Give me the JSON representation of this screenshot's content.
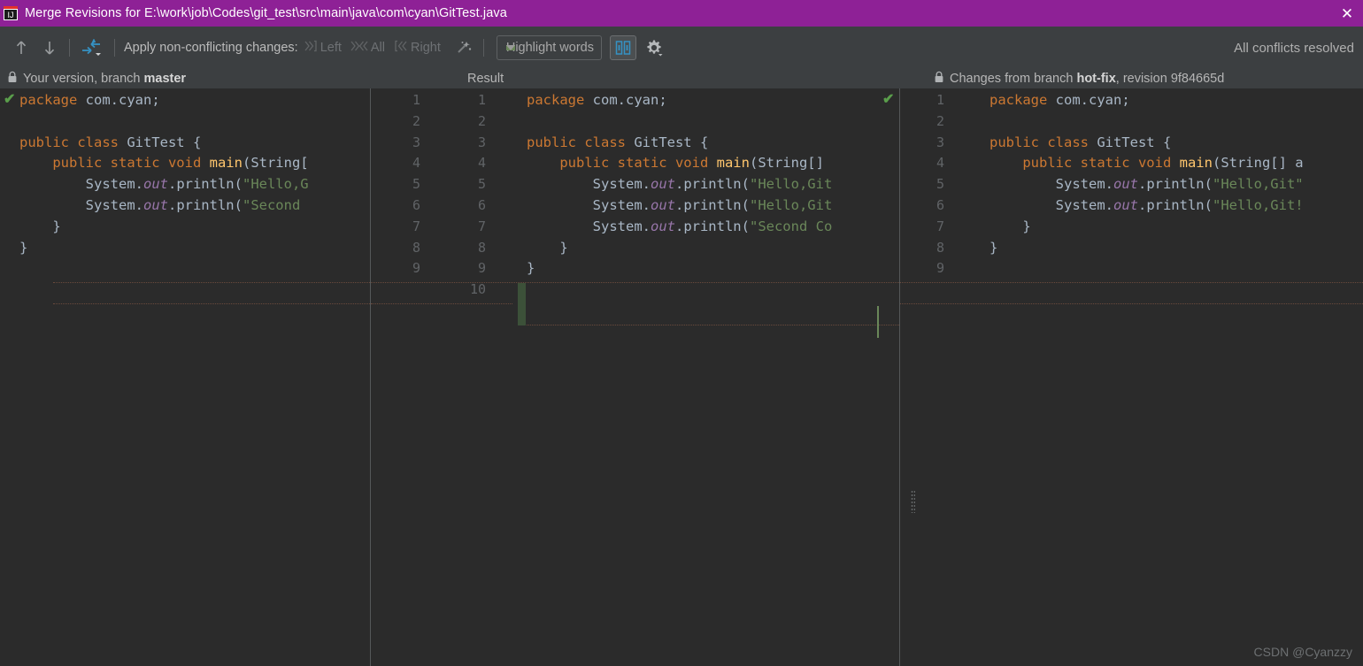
{
  "window": {
    "title": "Merge Revisions for E:\\work\\job\\Codes\\git_test\\src\\main\\java\\com\\cyan\\GitTest.java",
    "icon": "intellij-idea-icon",
    "close_label": "✕",
    "titlebar_color": "#8e2196"
  },
  "toolbar": {
    "prev_difference_icon": "arrow-up-icon",
    "next_difference_icon": "arrow-down-icon",
    "apply_changes_icon": "apply-changes-icon",
    "apply_label": "Apply non-conflicting changes:",
    "actions": [
      {
        "label": "Left",
        "icon": "chevron-right-bracket-icon",
        "enabled": false
      },
      {
        "label": "All",
        "icon": "chevrons-both-icon",
        "enabled": false
      },
      {
        "label": "Right",
        "icon": "bracket-chevron-left-icon",
        "enabled": false
      }
    ],
    "magic_resolve_icon": "magic-wand-icon",
    "highlight_mode": "Highlight words",
    "highlight_caret_icon": "chevron-down-icon",
    "collapse_panes_icon": "two-pane-toggle-icon",
    "collapse_panes_active": true,
    "settings_icon": "gear-icon",
    "conflicts_status": "All conflicts resolved"
  },
  "panes": {
    "left": {
      "lock_icon": "lock-icon",
      "header_prefix": "Your version, branch ",
      "header_branch": "master",
      "accept_icon": "green-check-icon",
      "lines": [
        [
          {
            "t": "kw",
            "v": "package"
          },
          {
            "t": "id",
            "v": " com.cyan;"
          }
        ],
        [],
        [
          {
            "t": "kw",
            "v": "public class"
          },
          {
            "t": "id",
            "v": " GitTest {"
          }
        ],
        [
          {
            "t": "id",
            "v": "    "
          },
          {
            "t": "kw",
            "v": "public static void"
          },
          {
            "t": "fn",
            "v": " main"
          },
          {
            "t": "pun",
            "v": "(String["
          }
        ],
        [
          {
            "t": "id",
            "v": "        System."
          },
          {
            "t": "fld",
            "v": "out"
          },
          {
            "t": "id",
            "v": ".println("
          },
          {
            "t": "str",
            "v": "\"Hello,G"
          }
        ],
        [
          {
            "t": "id",
            "v": "        System."
          },
          {
            "t": "fld",
            "v": "out"
          },
          {
            "t": "id",
            "v": ".println("
          },
          {
            "t": "str",
            "v": "\"Second "
          }
        ],
        [
          {
            "t": "id",
            "v": "    }"
          }
        ],
        [
          {
            "t": "id",
            "v": "}"
          }
        ]
      ]
    },
    "result": {
      "header": "Result",
      "accept_icon": "green-check-icon",
      "gutter_left": [
        "1",
        "2",
        "3",
        "4",
        "5",
        "6",
        "7",
        "8",
        "9"
      ],
      "gutter_right": [
        "1",
        "2",
        "3",
        "4",
        "5",
        "6",
        "7",
        "8",
        "9",
        "10"
      ],
      "lines": [
        [
          {
            "t": "kw",
            "v": "package"
          },
          {
            "t": "id",
            "v": " com.cyan;"
          }
        ],
        [],
        [
          {
            "t": "kw",
            "v": "public class"
          },
          {
            "t": "id",
            "v": " GitTest {"
          }
        ],
        [
          {
            "t": "id",
            "v": "    "
          },
          {
            "t": "kw",
            "v": "public static void"
          },
          {
            "t": "fn",
            "v": " main"
          },
          {
            "t": "pun",
            "v": "(String[]"
          }
        ],
        [
          {
            "t": "id",
            "v": "        System."
          },
          {
            "t": "fld",
            "v": "out"
          },
          {
            "t": "id",
            "v": ".println("
          },
          {
            "t": "str",
            "v": "\"Hello,Git"
          }
        ],
        [
          {
            "t": "id",
            "v": "        System."
          },
          {
            "t": "fld",
            "v": "out"
          },
          {
            "t": "id",
            "v": ".println("
          },
          {
            "t": "str",
            "v": "\"Hello,Git"
          }
        ],
        [
          {
            "t": "id",
            "v": "        System."
          },
          {
            "t": "fld",
            "v": "out"
          },
          {
            "t": "id",
            "v": ".println("
          },
          {
            "t": "str",
            "v": "\"Second Co"
          }
        ],
        [
          {
            "t": "id",
            "v": "    }"
          }
        ],
        [
          {
            "t": "id",
            "v": "}"
          }
        ]
      ]
    },
    "right": {
      "lock_icon": "lock-icon",
      "header_prefix": "Changes from branch ",
      "header_branch": "hot-fix",
      "header_suffix": ", revision 9f84665d",
      "accept_icon": "green-check-icon",
      "gutter": [
        "1",
        "2",
        "3",
        "4",
        "5",
        "6",
        "7",
        "8",
        "9"
      ],
      "lines": [
        [
          {
            "t": "kw",
            "v": "package"
          },
          {
            "t": "id",
            "v": " com.cyan;"
          }
        ],
        [],
        [
          {
            "t": "kw",
            "v": "public class"
          },
          {
            "t": "id",
            "v": " GitTest {"
          }
        ],
        [
          {
            "t": "id",
            "v": "    "
          },
          {
            "t": "kw",
            "v": "public static void"
          },
          {
            "t": "fn",
            "v": " main"
          },
          {
            "t": "pun",
            "v": "(String[] a"
          }
        ],
        [
          {
            "t": "id",
            "v": "        System."
          },
          {
            "t": "fld",
            "v": "out"
          },
          {
            "t": "id",
            "v": ".println("
          },
          {
            "t": "str",
            "v": "\"Hello,Git\""
          }
        ],
        [
          {
            "t": "id",
            "v": "        System."
          },
          {
            "t": "fld",
            "v": "out"
          },
          {
            "t": "id",
            "v": ".println("
          },
          {
            "t": "str",
            "v": "\"Hello,Git!"
          }
        ],
        [
          {
            "t": "id",
            "v": "    }"
          }
        ],
        [
          {
            "t": "id",
            "v": "}"
          }
        ]
      ]
    }
  },
  "watermark": "CSDN @Cyanzzy",
  "colors": {
    "title_bg": "#8e2196",
    "toolbar_bg": "#3c3f41",
    "editor_bg": "#2b2b2b",
    "keyword": "#cc7832",
    "string": "#6a8759",
    "field": "#9876aa",
    "method": "#ffc66d",
    "identifier": "#a9b7c6",
    "change_marker": "#3c5139",
    "accent": "#4a88c7"
  }
}
